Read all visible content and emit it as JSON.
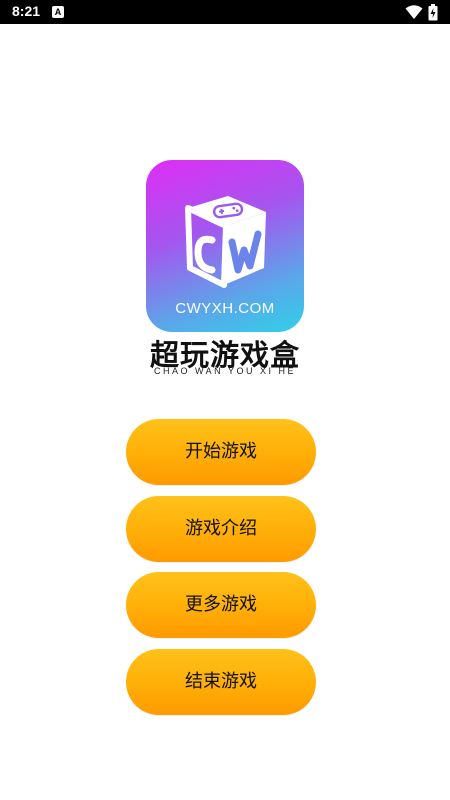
{
  "statusbar": {
    "time": "8:21",
    "notification_icon": "A"
  },
  "logo": {
    "domain": "CWYXH.COM",
    "icon": "game-cube-logo"
  },
  "app": {
    "title": "超玩游戏盒",
    "subtitle": "CHAO WAN YOU XI HE"
  },
  "menu": {
    "start": "开始游戏",
    "intro": "游戏介绍",
    "more": "更多游戏",
    "exit": "结束游戏"
  },
  "colors": {
    "button_top": "#ffc21a",
    "button_bottom": "#ff9a00",
    "logo_gradient_start": "#e02df5",
    "logo_gradient_end": "#2fd0e8"
  }
}
